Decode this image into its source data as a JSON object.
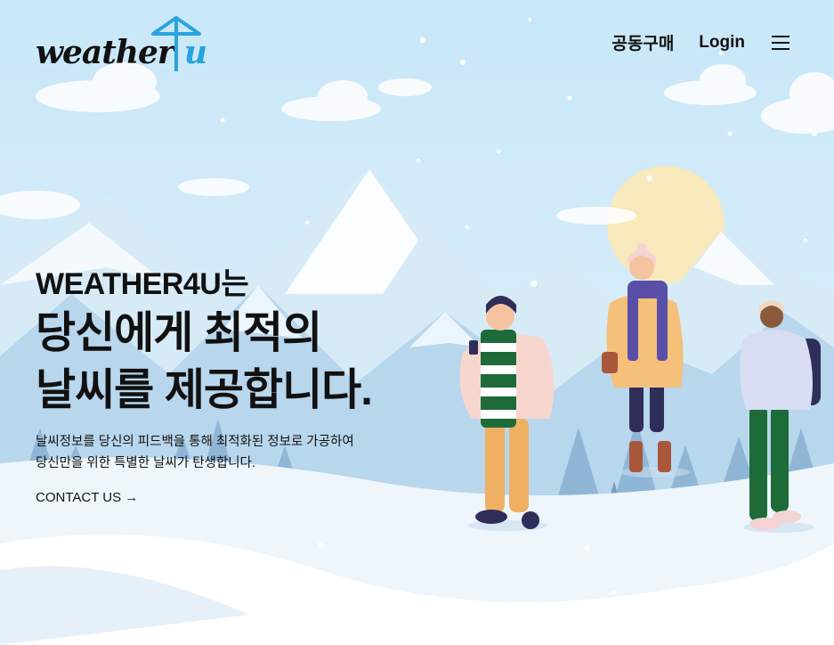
{
  "brand": {
    "logo_word": "weather",
    "logo_accent": "u",
    "accent_color": "#29a3e0"
  },
  "nav": {
    "group_buy": "공동구매",
    "login": "Login",
    "menu_icon": "hamburger-menu-icon"
  },
  "hero": {
    "eyebrow": "WEATHER4U는",
    "headline_line1": "당신에게 최적의",
    "headline_line2": "날씨를 제공합니다.",
    "desc_line1": "날씨정보를 당신의 피드백을 통해 최적화된 정보로 가공하여",
    "desc_line2": "당신만을 위한 특별한 날씨가 탄생합니다.",
    "cta": "CONTACT US →"
  }
}
